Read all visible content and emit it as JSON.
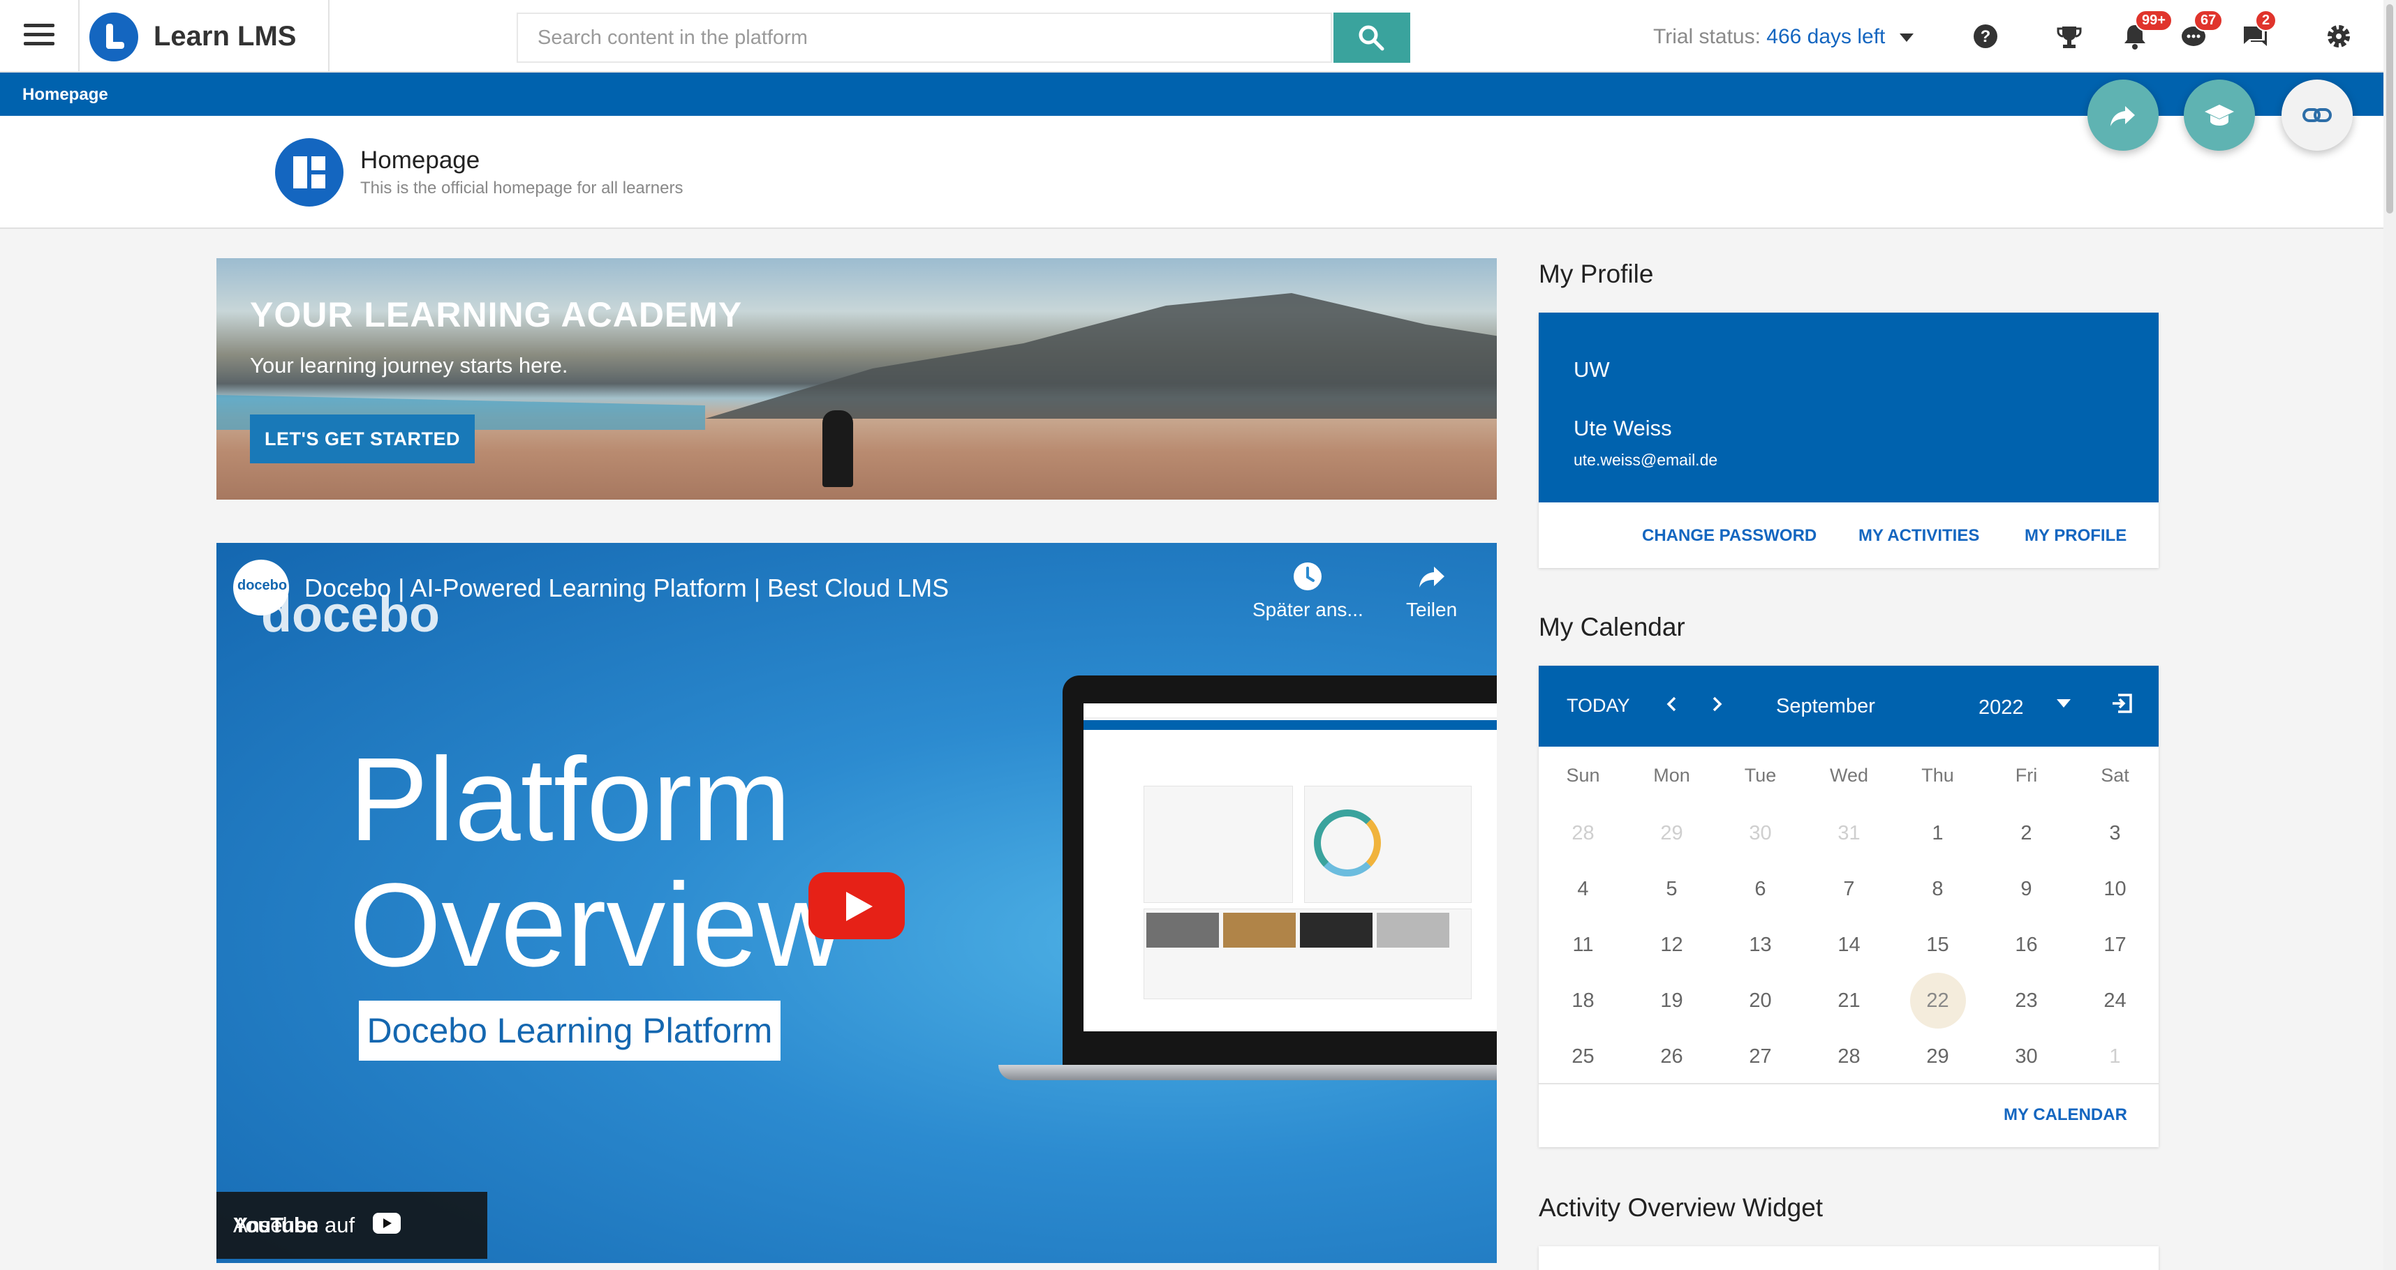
{
  "app": {
    "name": "Learn LMS"
  },
  "search": {
    "placeholder": "Search content in the platform"
  },
  "trial": {
    "prefix": "Trial status:",
    "days": "466 days left"
  },
  "badges": {
    "trophy_notifications": "99+",
    "chat": "67",
    "messages": "2"
  },
  "breadcrumb": {
    "current": "Homepage"
  },
  "page": {
    "title": "Homepage",
    "subtitle": "This is the official homepage for all learners"
  },
  "banner": {
    "title": "YOUR LEARNING ACADEMY",
    "subtitle": "Your learning journey starts here.",
    "button": "LET'S GET STARTED"
  },
  "video": {
    "channel_logo": "docebo",
    "wordmark": "docebo",
    "title": "Docebo | AI-Powered Learning Platform | Best Cloud LMS",
    "watch_later": "Später ans...",
    "share": "Teilen",
    "big_line1": "Platform",
    "big_line2": "Overview",
    "box_text": "Docebo Learning Platform",
    "watch_on": "Ansehen auf",
    "youtube": "YouTube"
  },
  "profile": {
    "section_title": "My Profile",
    "initials": "UW",
    "name": "Ute Weiss",
    "email": "ute.weiss@email.de",
    "links": [
      "CHANGE PASSWORD",
      "MY ACTIVITIES",
      "MY PROFILE"
    ]
  },
  "calendar": {
    "section_title": "My Calendar",
    "today_label": "TODAY",
    "month": "September",
    "year": "2022",
    "weekdays": [
      "Sun",
      "Mon",
      "Tue",
      "Wed",
      "Thu",
      "Fri",
      "Sat"
    ],
    "weeks": [
      [
        "28",
        "29",
        "30",
        "31",
        "1",
        "2",
        "3"
      ],
      [
        "4",
        "5",
        "6",
        "7",
        "8",
        "9",
        "10"
      ],
      [
        "11",
        "12",
        "13",
        "14",
        "15",
        "16",
        "17"
      ],
      [
        "18",
        "19",
        "20",
        "21",
        "22",
        "23",
        "24"
      ],
      [
        "25",
        "26",
        "27",
        "28",
        "29",
        "30",
        "1"
      ]
    ],
    "today": "22",
    "footer_link": "MY CALENDAR"
  },
  "activity": {
    "section_title": "Activity Overview Widget"
  },
  "colors": {
    "brand_blue": "#0062ae",
    "accent_teal": "#3aa39d",
    "badge_red": "#e0342c"
  }
}
